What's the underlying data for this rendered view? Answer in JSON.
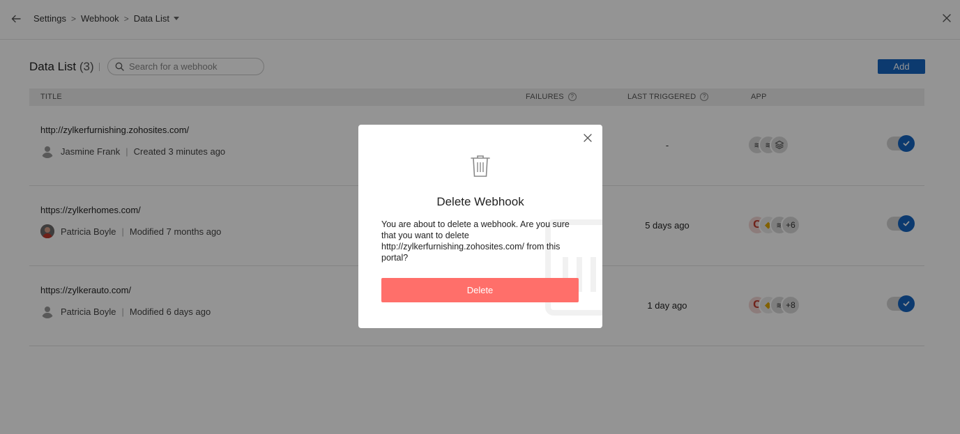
{
  "breadcrumb": {
    "items": [
      "Settings",
      "Webhook",
      "Data List"
    ],
    "separator": ">"
  },
  "header": {
    "title": "Data List",
    "count": "(3)",
    "search_placeholder": "Search for a webhook",
    "add_label": "Add"
  },
  "table": {
    "columns": {
      "title": "TITLE",
      "failures": "FAILURES",
      "last_triggered": "LAST TRIGGERED",
      "app": "APP"
    },
    "help_glyph": "?",
    "rows": [
      {
        "url": "http://zylkerfurnishing.zohosites.com/",
        "user": "Jasmine Frank",
        "action": "Created 3 minutes ago",
        "last_triggered": "-",
        "extra_apps": "",
        "enabled": true
      },
      {
        "url": "https://zylkerhomes.com/",
        "user": "Patricia Boyle",
        "action": "Modified 7 months ago",
        "last_triggered": "5 days ago",
        "extra_apps": "+6",
        "enabled": true
      },
      {
        "url": "https://zylkerauto.com/",
        "user": "Patricia Boyle",
        "action": "Modified 6 days ago",
        "last_triggered": "1 day ago",
        "extra_apps": "+8",
        "enabled": true
      }
    ]
  },
  "modal": {
    "title": "Delete Webhook",
    "message": "You are about to delete a webhook. Are you sure that you want to delete http://zylkerfurnishing.zohosites.com/ from this portal?",
    "delete_label": "Delete"
  },
  "colors": {
    "accent": "#1565c0",
    "danger": "#ff6f6a",
    "overlay": "rgba(0,0,0,0.42)"
  },
  "icons": {
    "back": "arrow-left-icon",
    "close": "close-icon",
    "search": "search-icon",
    "trash": "trash-icon",
    "check": "check-icon"
  }
}
